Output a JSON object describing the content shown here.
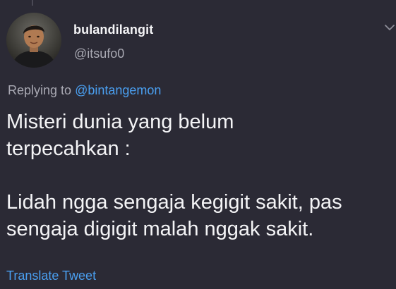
{
  "author": {
    "display_name": "bulandilangit",
    "handle": "@itsufo0",
    "avatar_icon": "user-avatar-photo"
  },
  "reply": {
    "prefix": "Replying to ",
    "mention": "@bintangemon"
  },
  "tweet": {
    "lines": [
      "Misteri dunia yang belum",
      "terpecahkan :",
      "",
      "Lidah ngga sengaja kegigit sakit, pas",
      "sengaja digigit malah nggak sakit."
    ]
  },
  "actions": {
    "translate_label": "Translate Tweet",
    "menu_icon": "chevron-down-icon"
  },
  "colors": {
    "background": "#2b2a35",
    "primary_text": "#f4f4f6",
    "secondary_text": "#a9a9b3",
    "link": "#4a9ff0"
  }
}
